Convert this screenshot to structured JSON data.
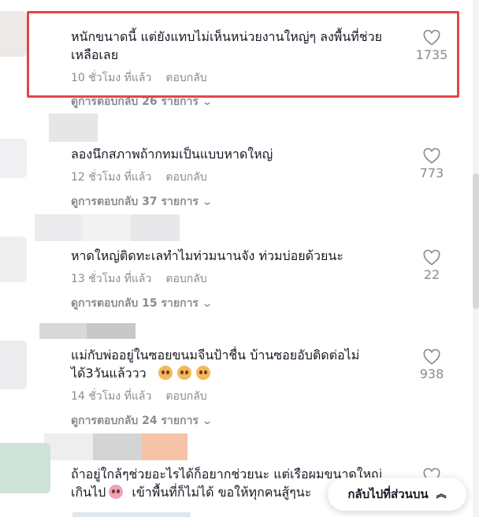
{
  "comments": [
    {
      "text_line1": "หนักขนาดนี้ แต่ยังแทบไม่เห็นหน่วยงานใหญ่ๆ ลงพื้นที่ช่วย",
      "text_line2": "เหลือเลย",
      "time": "10 ชั่วโมง ที่แล้ว",
      "reply": "ตอบกลับ",
      "replies_label": "ดูการตอบกลับ 26 รายการ",
      "likes": "1735"
    },
    {
      "text_line1": "ลองนึกสภาพถ้ากทมเป็นแบบหาดใหญ่",
      "time": "12 ชั่วโมง ที่แล้ว",
      "reply": "ตอบกลับ",
      "replies_label": "ดูการตอบกลับ 37 รายการ",
      "likes": "773"
    },
    {
      "text_line1": "หาดใหญ่ติดทะเลทำไมท่วมนานจัง ท่วมบ่อยด้วยนะ",
      "time": "13 ชั่วโมง ที่แล้ว",
      "reply": "ตอบกลับ",
      "replies_label": "ดูการตอบกลับ 15 รายการ",
      "likes": "22"
    },
    {
      "text_line1": "แม่กับพ่ออยู่ในซอยขนมจีนป้าชื่น บ้านซอยอับติดต่อไม่",
      "text_line2": "ได้3วันแล้ววว",
      "time": "14 ชั่วโมง ที่แล้ว",
      "reply": "ตอบกลับ",
      "replies_label": "ดูการตอบกลับ 24 รายการ",
      "likes": "938"
    },
    {
      "text_line1": "ถ้าอยู่ใกล้ๆช่วยอะไรได้ก็อยากช่วยนะ แต่เรือผมขนาดใหญ่",
      "text_line2": "เกินไป",
      "text_line2b": "เข้าพื้นที่ก็ไม่ได้ ขอให้ทุกคนสู้ๆนะ"
    }
  ],
  "back_to_top": "กลับไปที่ส่วนบน",
  "icons": {
    "like": "heart-outline-icon",
    "chevron": "chevron-down-icon",
    "up": "double-chevron-up-icon"
  },
  "colors": {
    "highlight": "#e0464b",
    "muted": "#8a8b91",
    "text": "#161823"
  }
}
